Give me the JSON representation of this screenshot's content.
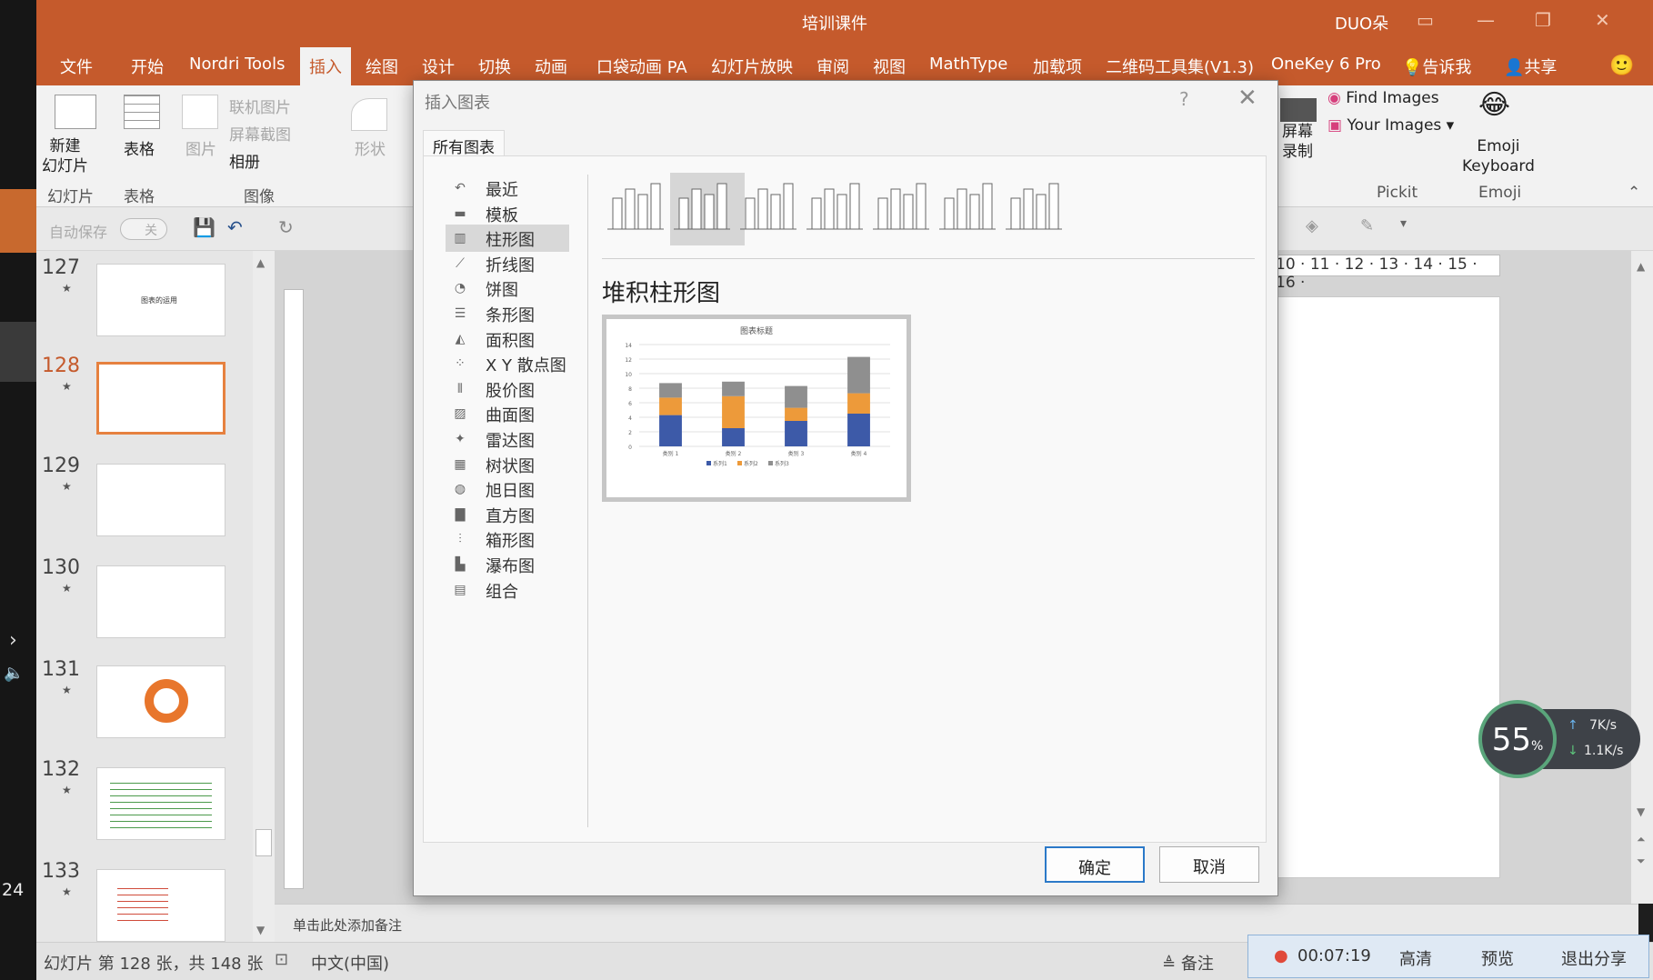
{
  "left_strip": {
    "slide_counter": "24"
  },
  "titlebar": {
    "title": "培训课件",
    "user": "DUO朵"
  },
  "tabs": [
    {
      "label": "文件"
    },
    {
      "label": "开始"
    },
    {
      "label": "Nordri Tools"
    },
    {
      "label": "插入"
    },
    {
      "label": "绘图"
    },
    {
      "label": "设计"
    },
    {
      "label": "切换"
    },
    {
      "label": "动画"
    },
    {
      "label": "口袋动画 PA"
    },
    {
      "label": "幻灯片放映"
    },
    {
      "label": "审阅"
    },
    {
      "label": "视图"
    },
    {
      "label": "MathType"
    },
    {
      "label": "加载项"
    },
    {
      "label": "二维码工具集(V1.3)"
    },
    {
      "label": "OneKey 6 Pro"
    },
    {
      "label": "告诉我"
    },
    {
      "label": "共享"
    }
  ],
  "ribbon": {
    "new_slide": "新建\n幻灯片",
    "group_slides": "幻灯片",
    "table": "表格",
    "group_table": "表格",
    "picture": "图片",
    "online_pic": "联机图片",
    "screenshot": "屏幕截图",
    "album": "相册",
    "group_image": "图像",
    "shape": "形状",
    "screen_record": "屏幕\n录制",
    "find_images": "Find Images",
    "your_images": "Your Images",
    "group_pickit": "Pickit",
    "emoji_keyboard": "Emoji\nKeyboard",
    "group_emoji": "Emoji"
  },
  "qat": {
    "autosave": "自动保存",
    "autosave_state": "关"
  },
  "slides": [
    {
      "num": "127",
      "thumb_text": "图表的运用"
    },
    {
      "num": "128",
      "thumb_text": ""
    },
    {
      "num": "129",
      "thumb_text": ""
    },
    {
      "num": "130",
      "thumb_text": ""
    },
    {
      "num": "131",
      "thumb_text": ""
    },
    {
      "num": "132",
      "thumb_text": ""
    },
    {
      "num": "133",
      "thumb_text": ""
    }
  ],
  "ruler": {
    "h_ticks": "10 · 11 · 12 · 13 · 14 · 15 · 16 ·"
  },
  "notes": {
    "placeholder": "单击此处添加备注"
  },
  "status": {
    "slide_info": "幻灯片 第 128 张，共 148 张",
    "language": "中文(中国)",
    "notes_btn": "备注"
  },
  "sharebar": {
    "time": "00:07:19",
    "hd": "高清",
    "preview": "预览",
    "exit": "退出分享"
  },
  "speed": {
    "percent": "55",
    "unit": "%",
    "up": "7K/s",
    "down": "1.1K/s"
  },
  "dialog": {
    "title": "插入图表",
    "help": "?",
    "tab": "所有图表",
    "categories": [
      "最近",
      "模板",
      "柱形图",
      "折线图",
      "饼图",
      "条形图",
      "面积图",
      "X Y 散点图",
      "股价图",
      "曲面图",
      "雷达图",
      "树状图",
      "旭日图",
      "直方图",
      "箱形图",
      "瀑布图",
      "组合"
    ],
    "selected_category": "柱形图",
    "subtype_name": "堆积柱形图",
    "ok": "确定",
    "cancel": "取消"
  },
  "chart_data": {
    "type": "bar",
    "stacked": true,
    "title": "图表标题",
    "categories": [
      "类别 1",
      "类别 2",
      "类别 3",
      "类别 4"
    ],
    "series": [
      {
        "name": "系列1",
        "values": [
          4.3,
          2.5,
          3.5,
          4.5
        ],
        "color": "#3d5aa8"
      },
      {
        "name": "系列2",
        "values": [
          2.4,
          4.4,
          1.8,
          2.8
        ],
        "color": "#ed9a3a"
      },
      {
        "name": "系列3",
        "values": [
          2,
          2,
          3,
          5
        ],
        "color": "#8f8f8f"
      }
    ],
    "ylim": [
      0,
      14
    ],
    "yticks": [
      0,
      2,
      4,
      6,
      8,
      10,
      12,
      14
    ],
    "grid": true,
    "legend": "bottom"
  },
  "colors": {
    "accent": "#c55a2c",
    "selected_thumb": "#e6813f",
    "ok_border": "#2b79c8"
  }
}
